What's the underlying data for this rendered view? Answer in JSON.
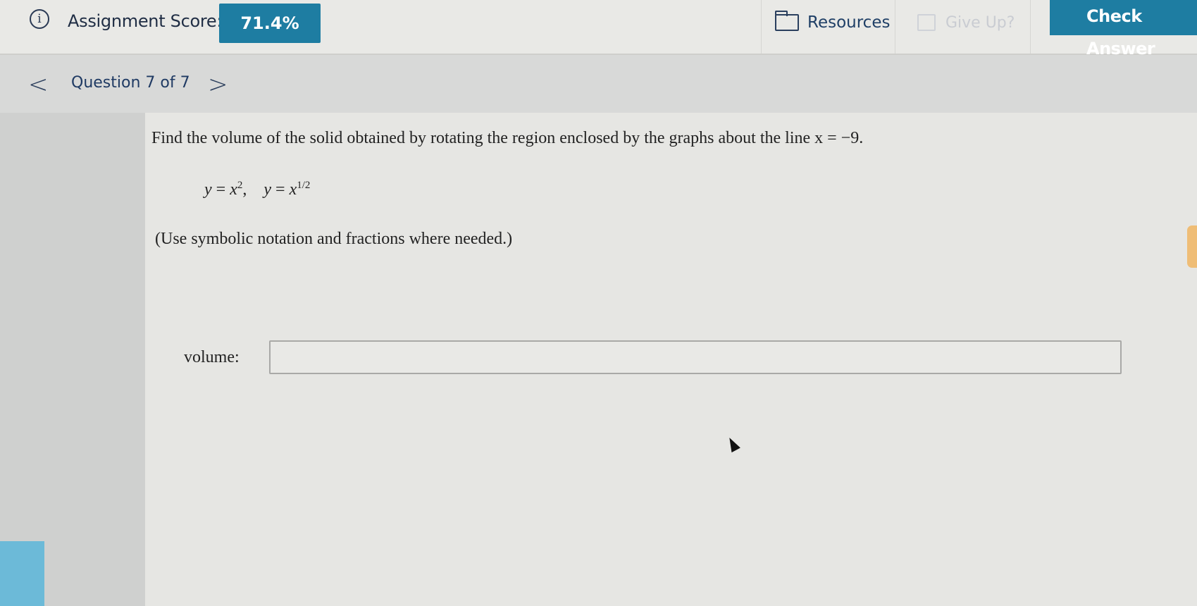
{
  "header": {
    "score_label": "Assignment Score:",
    "score_value": "71.4%",
    "resources_label": "Resources",
    "give_up_label": "Give Up?",
    "check_answer_label": "Check Answer"
  },
  "nav": {
    "prev_glyph": "<",
    "next_glyph": ">",
    "question_counter": "Question 7 of 7"
  },
  "question": {
    "prompt": "Find the volume of the solid obtained by rotating the region enclosed by the graphs about the line x = −9.",
    "hint": "(Use symbolic notation and fractions where needed.)",
    "answer_label": "volume:",
    "answer_value": ""
  },
  "colors": {
    "accent": "#1e7da2",
    "nav_text": "#1f3a63"
  },
  "icons": [
    "info-icon",
    "folder-icon",
    "flag-icon",
    "chevron-left-icon",
    "chevron-right-icon",
    "mouse-cursor-icon"
  ]
}
